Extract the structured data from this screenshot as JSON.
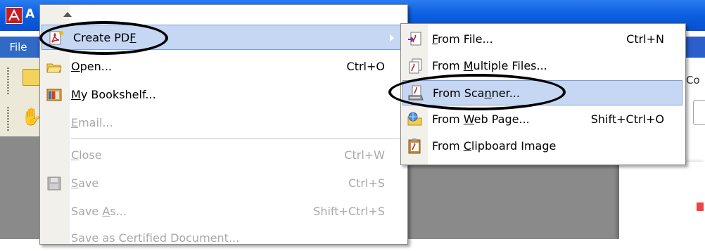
{
  "app": {
    "title_fragment": "A",
    "menubar_file": "File",
    "right_panel_label": "Co"
  },
  "file_menu": {
    "items": [
      {
        "label": "Create PDF",
        "mnemonic": "F",
        "shortcut": "",
        "enabled": true,
        "highlighted": true,
        "has_submenu": true,
        "icon": "create-pdf-icon"
      },
      {
        "label": "Open...",
        "mnemonic": "O",
        "shortcut": "Ctrl+O",
        "enabled": true,
        "icon": "open-folder-icon"
      },
      {
        "label": "My Bookshelf...",
        "mnemonic": "M",
        "shortcut": "",
        "enabled": true,
        "icon": "bookshelf-icon"
      },
      {
        "label": "Email...",
        "mnemonic": "E",
        "shortcut": "",
        "enabled": false,
        "icon": ""
      },
      {
        "label": "Close",
        "mnemonic": "C",
        "shortcut": "Ctrl+W",
        "enabled": false,
        "icon": ""
      },
      {
        "label": "Save",
        "mnemonic": "S",
        "shortcut": "Ctrl+S",
        "enabled": false,
        "icon": "save-disk-icon"
      },
      {
        "label": "Save As...",
        "mnemonic": "A",
        "shortcut": "Shift+Ctrl+S",
        "enabled": false,
        "icon": ""
      },
      {
        "label": "Save as Certified Document...",
        "mnemonic": "",
        "shortcut": "",
        "enabled": false,
        "icon": ""
      }
    ]
  },
  "submenu": {
    "items": [
      {
        "label": "From File...",
        "mnemonic": "F",
        "shortcut": "Ctrl+N",
        "highlighted": false,
        "icon": "from-file-icon"
      },
      {
        "label": "From Multiple Files...",
        "mnemonic": "M",
        "shortcut": "",
        "highlighted": false,
        "icon": "from-multiple-files-icon"
      },
      {
        "label": "From Scanner...",
        "mnemonic": "n",
        "shortcut": "",
        "highlighted": true,
        "icon": "from-scanner-icon"
      },
      {
        "label": "From Web Page...",
        "mnemonic": "W",
        "shortcut": "Shift+Ctrl+O",
        "highlighted": false,
        "icon": "from-web-page-icon"
      },
      {
        "label": "From Clipboard Image",
        "mnemonic": "C",
        "shortcut": "",
        "highlighted": false,
        "icon": "from-clipboard-icon"
      }
    ]
  },
  "colors": {
    "highlight_bg": "#c6d7f3",
    "highlight_border": "#7e9fd4",
    "disabled_text": "#a8a8a8",
    "title_bar_blue": "#0b5ee0",
    "pdf_red": "#c61d23"
  }
}
